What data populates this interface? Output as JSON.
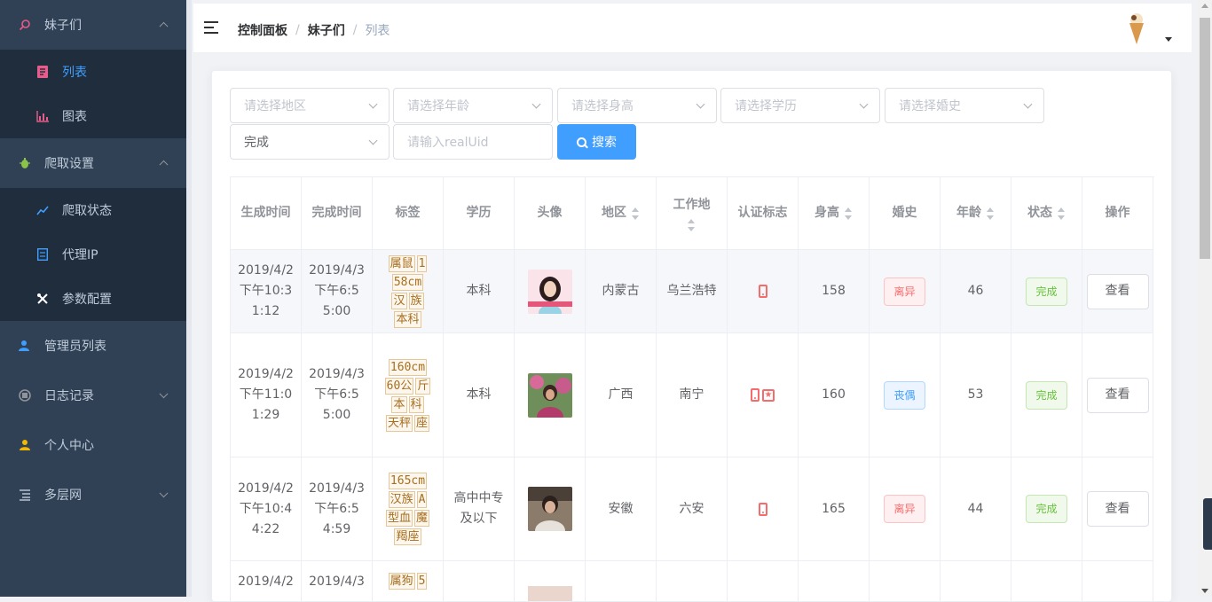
{
  "sidebar": {
    "items": [
      {
        "label": "妹子们",
        "icon": "search-icon",
        "expanded": true
      },
      {
        "label": "列表",
        "icon": "list-icon",
        "active": true
      },
      {
        "label": "图表",
        "icon": "chart-icon"
      },
      {
        "label": "爬取设置",
        "icon": "bug-icon",
        "expanded": true
      },
      {
        "label": "爬取状态",
        "icon": "trend-icon"
      },
      {
        "label": "代理IP",
        "icon": "document-icon"
      },
      {
        "label": "参数配置",
        "icon": "tools-icon"
      },
      {
        "label": "管理员列表",
        "icon": "admin-icon"
      },
      {
        "label": "日志记录",
        "icon": "log-icon",
        "expanded": false
      },
      {
        "label": "个人中心",
        "icon": "user-icon"
      },
      {
        "label": "多层网",
        "icon": "tree-icon",
        "expanded": false
      }
    ]
  },
  "header": {
    "breadcrumb": [
      "控制面板",
      "妹子们",
      "列表"
    ]
  },
  "filters": {
    "region": "请选择地区",
    "age": "请选择年龄",
    "height": "请选择身高",
    "education": "请选择学历",
    "marriage": "请选择婚史",
    "status": "完成",
    "realuid_placeholder": "请输入realUid",
    "search_label": "搜索"
  },
  "table": {
    "headers": [
      "生成时间",
      "完成时间",
      "标签",
      "学历",
      "头像",
      "地区",
      "工作地",
      "认证标志",
      "身高",
      "婚史",
      "年龄",
      "状态",
      "操作"
    ],
    "rows": [
      {
        "created": [
          "2019/4/2",
          "下午10:3",
          "1:12"
        ],
        "finished": [
          "2019/4/3",
          "下午6:5",
          "5:00"
        ],
        "tags": [
          "属鼠",
          "1",
          "58cm",
          "汉",
          "族",
          "本科"
        ],
        "education": "本科",
        "region": "内蒙古",
        "workplace": "乌兰浩特",
        "verified": [
          "phone"
        ],
        "height": "158",
        "marriage": "离异",
        "marriage_type": "danger",
        "age": "46",
        "status": "完成",
        "action": "查看"
      },
      {
        "created": [
          "2019/4/2",
          "下午11:0",
          "1:29"
        ],
        "finished": [
          "2019/4/3",
          "下午6:5",
          "5:00"
        ],
        "tags": [
          "160cm",
          "60公",
          "斤",
          "本",
          "科",
          "天秤",
          "座"
        ],
        "education": "本科",
        "region": "广西",
        "workplace": "南宁",
        "verified": [
          "phone",
          "star"
        ],
        "height": "160",
        "marriage": "丧偶",
        "marriage_type": "info",
        "age": "53",
        "status": "完成",
        "action": "查看"
      },
      {
        "created": [
          "2019/4/2",
          "下午10:4",
          "4:22"
        ],
        "finished": [
          "2019/4/3",
          "下午6:5",
          "4:59"
        ],
        "tags": [
          "165cm",
          "汉族",
          "A",
          "型血",
          "魔",
          "羯座"
        ],
        "education": "高中中专及以下",
        "region": "安徽",
        "workplace": "六安",
        "verified": [
          "phone"
        ],
        "height": "165",
        "marriage": "离异",
        "marriage_type": "danger",
        "age": "44",
        "status": "完成",
        "action": "查看"
      },
      {
        "created": [
          "2019/4/2"
        ],
        "finished": [
          "2019/4/3"
        ],
        "tags": [
          "属狗",
          "5"
        ]
      }
    ]
  },
  "colors": {
    "sidebar_bg": "#304156",
    "accent": "#409eff"
  }
}
